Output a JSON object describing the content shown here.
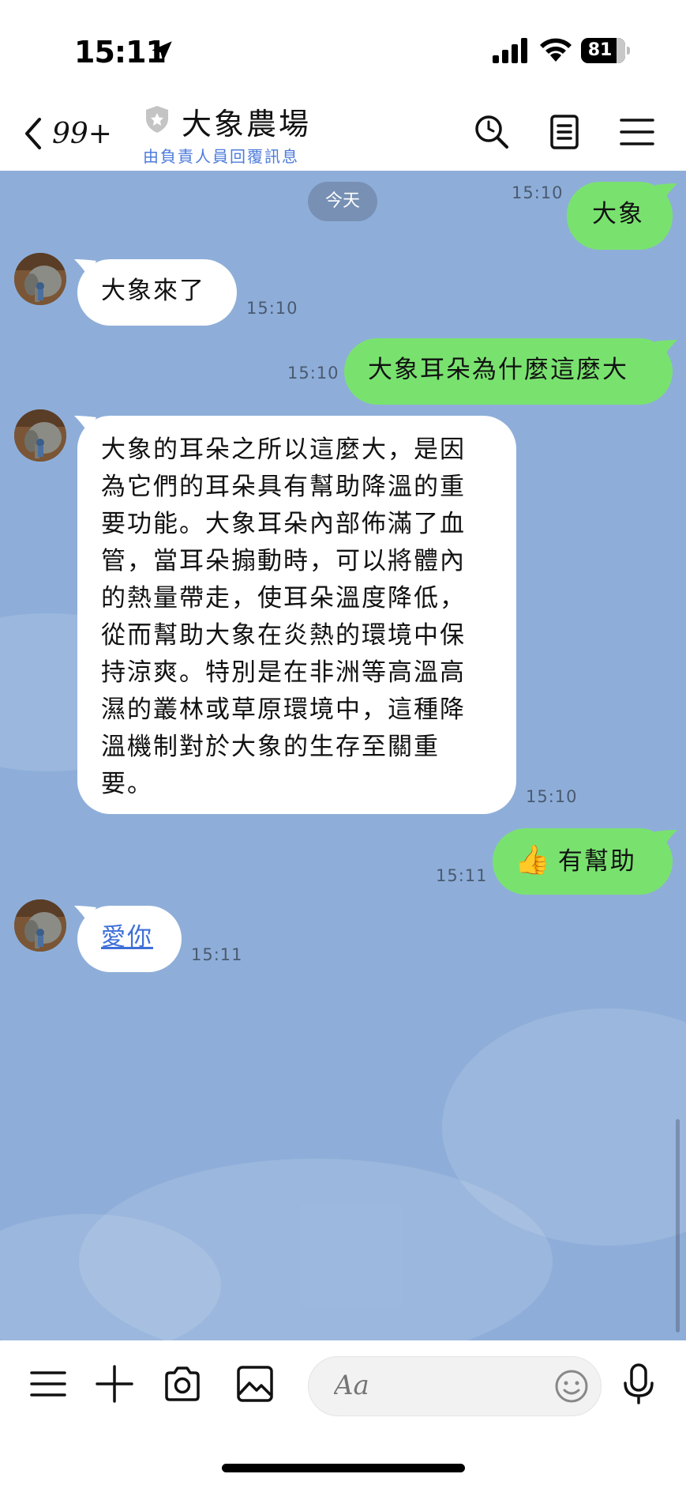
{
  "status_bar": {
    "time": "15:11",
    "battery": "81",
    "battery_level": 0.81
  },
  "header": {
    "unread_count": "99+",
    "title": "大象農場",
    "subtitle": "由負責人員回覆訊息"
  },
  "chat": {
    "date_divider": "今天",
    "messages": [
      {
        "sender": "me",
        "text": "大象",
        "time": "15:10"
      },
      {
        "sender": "them",
        "text": "大象來了",
        "time": "15:10"
      },
      {
        "sender": "me",
        "text": "大象耳朵為什麼這麼大",
        "time": "15:10"
      },
      {
        "sender": "them",
        "lines": [
          "大象的耳朵之所以這麼大，是因",
          "為它們的耳朵具有幫助降溫的重",
          "要功能。大象耳朵內部佈滿了血",
          "管，當耳朵搧動時，可以將體內",
          "的熱量帶走，使耳朵溫度降低，",
          "從而幫助大象在炎熱的環境中保",
          "持涼爽。特別是在非洲等高溫高",
          "濕的叢林或草原環境中，這種降",
          "溫機制對於大象的生存至關重",
          "要。"
        ],
        "time": "15:10"
      },
      {
        "sender": "me",
        "emoji": "👍",
        "text": "有幫助",
        "time": "15:11"
      },
      {
        "sender": "them",
        "text": "愛你",
        "time": "15:11"
      }
    ]
  },
  "composer": {
    "placeholder": "Aa"
  },
  "colors": {
    "chat_background": "#8eaed9",
    "my_bubble": "#79e26f",
    "their_bubble": "#ffffff",
    "link": "#3f6fd8",
    "subtitle": "#4d7bdc"
  },
  "icons": {
    "header": [
      "chevron-left-icon",
      "shield-icon",
      "search-icon",
      "notes-icon",
      "menu-icon"
    ],
    "toolbar": [
      "menu-icon",
      "plus-icon",
      "camera-icon",
      "image-icon",
      "emoji-icon",
      "microphone-icon"
    ]
  }
}
